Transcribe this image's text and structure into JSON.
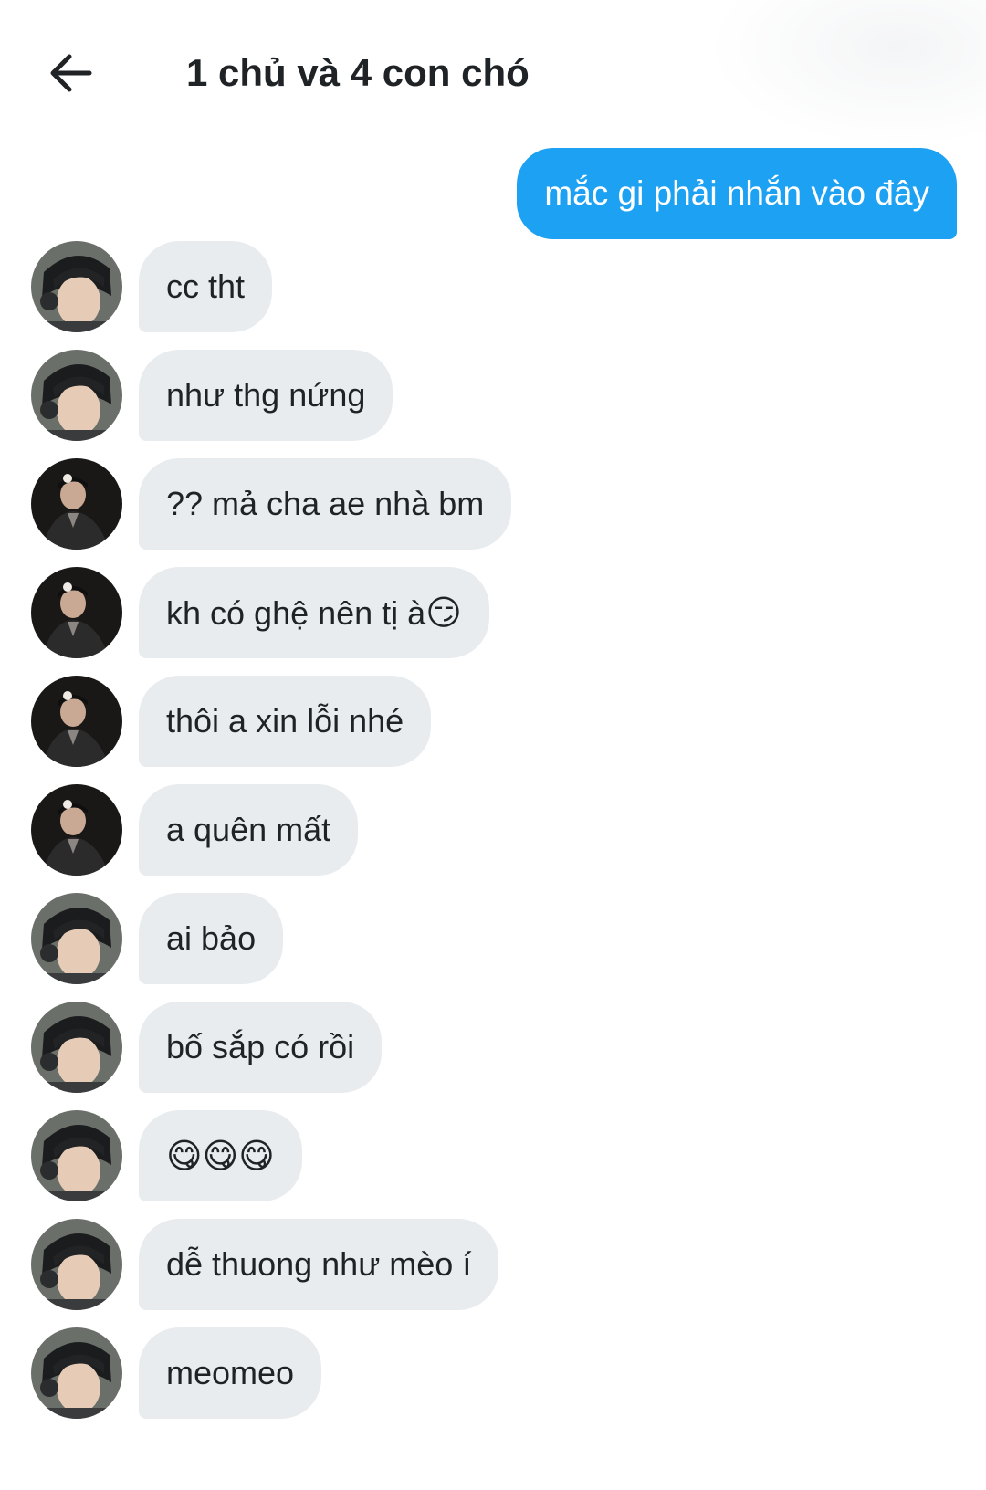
{
  "header": {
    "back_icon": "arrow-left-icon",
    "title": "1 chủ và 4 con chó"
  },
  "outgoing": {
    "text": "mắc gi phải nhắn vào đây",
    "color": "#1da1f2"
  },
  "incoming_bubble_color": "#e9ecef",
  "messages": [
    {
      "avatar": "avatar-headphones",
      "text": "cc tht"
    },
    {
      "avatar": "avatar-headphones",
      "text": "như thg nứng"
    },
    {
      "avatar": "avatar-dark-jacket",
      "text": "?? mả cha ae nhà bm"
    },
    {
      "avatar": "avatar-dark-jacket",
      "text": "kh có ghệ nên tị à",
      "emoji": "😏"
    },
    {
      "avatar": "avatar-dark-jacket",
      "text": "thôi a xin lỗi nhé"
    },
    {
      "avatar": "avatar-dark-jacket",
      "text": "a quên mất"
    },
    {
      "avatar": "avatar-headphones",
      "text": "ai bảo"
    },
    {
      "avatar": "avatar-headphones",
      "text": "bố sắp có rồi"
    },
    {
      "avatar": "avatar-headphones",
      "text": "",
      "emoji": "😋😋😋"
    },
    {
      "avatar": "avatar-headphones",
      "text": "dễ thuong như mèo í"
    },
    {
      "avatar": "avatar-headphones",
      "text": "meomeo"
    }
  ]
}
